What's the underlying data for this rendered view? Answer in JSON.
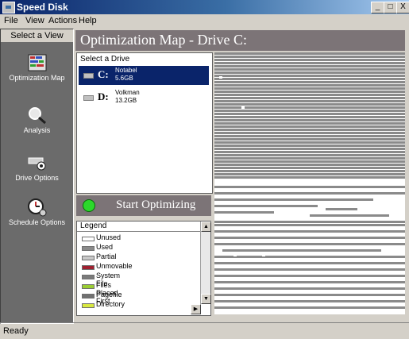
{
  "window": {
    "title": "Speed Disk",
    "buttons": {
      "minimize": "_",
      "maximize": "□",
      "close": "X"
    }
  },
  "menu": [
    "File",
    "View",
    "Actions",
    "Help"
  ],
  "sidebar": {
    "header": "Select a View",
    "items": [
      {
        "label": "Optimization Map",
        "icon": "disk-map-icon"
      },
      {
        "label": "Analysis",
        "icon": "magnifier-icon"
      },
      {
        "label": "Drive Options",
        "icon": "drive-gear-icon"
      },
      {
        "label": "Schedule Options",
        "icon": "clock-icon"
      }
    ]
  },
  "main": {
    "title": "Optimization Map - Drive C:",
    "drive_select_label": "Select a Drive",
    "drives": [
      {
        "letter": "C:",
        "name": "Notabel",
        "size": "5.6GB",
        "selected": true
      },
      {
        "letter": "D:",
        "name": "Volkman",
        "size": "13.2GB",
        "selected": false
      }
    ],
    "start_button": "Start Optimizing",
    "legend": {
      "header": "Legend",
      "items": [
        {
          "label": "Unused",
          "color": "#ffffff"
        },
        {
          "label": "Used",
          "color": "#8a8a8a"
        },
        {
          "label": "Partial",
          "color": "#c8c8c8"
        },
        {
          "label": "Unmovable",
          "color": "#a02030"
        },
        {
          "label": "System File",
          "color": "#7a7a7a"
        },
        {
          "label": "Files Placed First",
          "color": "#9acd32"
        },
        {
          "label": "Pagefile",
          "color": "#707070"
        },
        {
          "label": "Directory",
          "color": "#d8e840"
        }
      ]
    }
  },
  "colors": {
    "accent": "#7c7477",
    "panel": "#6b6b6b",
    "map_used": "#8a8a8a",
    "start_led": "#2bd82b"
  },
  "status": "Ready"
}
